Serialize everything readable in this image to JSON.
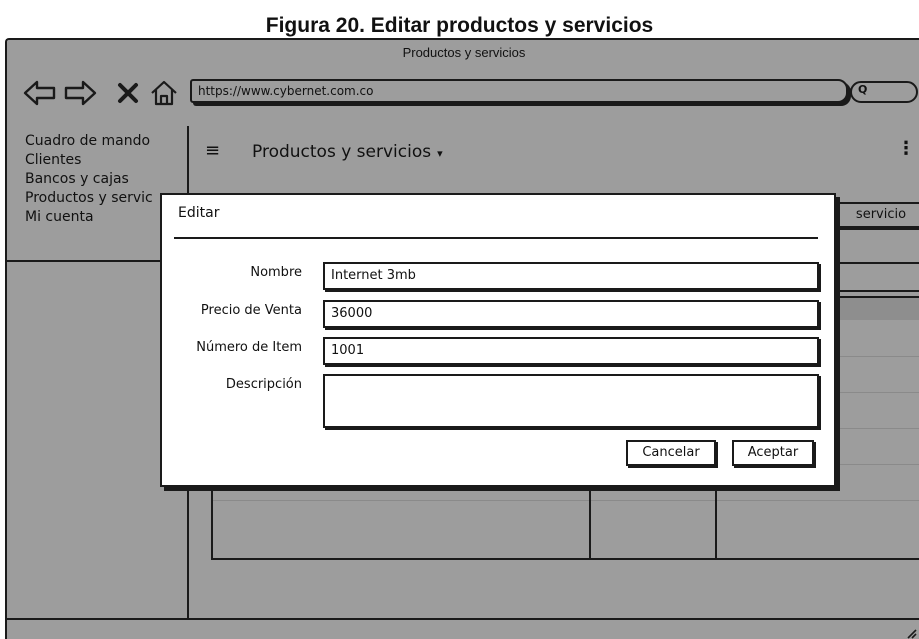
{
  "figure": {
    "caption": "Figura 20. Editar productos y servicios"
  },
  "browser": {
    "window_title": "Productos y servicios",
    "url": "https://www.cybernet.com.co",
    "search_glyph": "Q",
    "icons": [
      "back-arrow-icon",
      "forward-arrow-icon",
      "close-icon",
      "home-icon",
      "search-icon"
    ]
  },
  "sidebar": {
    "items": [
      {
        "label": "Cuadro de mando"
      },
      {
        "label": "Clientes"
      },
      {
        "label": "Bancos y cajas"
      },
      {
        "label": "Productos y servic"
      },
      {
        "label": "Mi cuenta"
      }
    ]
  },
  "header": {
    "menu_icon": "≡",
    "title": "Productos y servicios",
    "caret": "▾",
    "more_icon": "⋮"
  },
  "main": {
    "add_button_label": "servicio"
  },
  "dialog": {
    "title": "Editar",
    "fields": [
      {
        "label": "Nombre",
        "value": "Internet 3mb"
      },
      {
        "label": "Precio de Venta",
        "value": "36000"
      },
      {
        "label": "Número de Item",
        "value": "1001"
      },
      {
        "label": "Descripción",
        "value": ""
      }
    ],
    "cancel_label": "Cancelar",
    "accept_label": "Aceptar"
  },
  "colors": {
    "overlay_gray": "#9d9d9d",
    "ink": "#1a1a1a",
    "dialog_bg": "#ffffff"
  }
}
